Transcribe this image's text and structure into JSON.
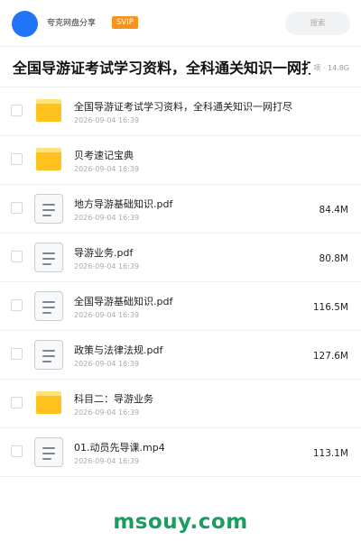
{
  "header": {
    "username": "夸克网盘分享",
    "badge": "SVIP",
    "search_placeholder": "搜索"
  },
  "share": {
    "title": "全国导游证考试学习资料，全科通关知识一网打尽",
    "meta": "项 · 14.8G"
  },
  "files": [
    {
      "type": "folder",
      "name": "全国导游证考试学习资料，全科通关知识一网打尽",
      "date": "2026-09-04 16:39",
      "size": ""
    },
    {
      "type": "folder",
      "name": "贝考速记宝典",
      "date": "2026-09-04 16:39",
      "size": ""
    },
    {
      "type": "doc",
      "name": "地方导游基础知识.pdf",
      "date": "2026-09-04 16:39",
      "size": "84.4M"
    },
    {
      "type": "doc",
      "name": "导游业务.pdf",
      "date": "2026-09-04 16:39",
      "size": "80.8M"
    },
    {
      "type": "doc",
      "name": "全国导游基础知识.pdf",
      "date": "2026-09-04 16:39",
      "size": "116.5M"
    },
    {
      "type": "doc",
      "name": "政策与法律法规.pdf",
      "date": "2026-09-04 16:39",
      "size": "127.6M"
    },
    {
      "type": "folder",
      "name": "科目二：导游业务",
      "date": "2026-09-04 16:39",
      "size": ""
    },
    {
      "type": "doc",
      "name": "01.动员先导课.mp4",
      "date": "2026-09-04 16:39",
      "size": "113.1M"
    }
  ],
  "watermark": "msouy.com",
  "colors": {
    "avatar": "#1f74f7",
    "badge": "#f8941d",
    "folder": "#ffc21f",
    "watermark": "#1a9d5e"
  },
  "icons": {
    "folder": "folder-icon",
    "doc": "document-icon"
  }
}
